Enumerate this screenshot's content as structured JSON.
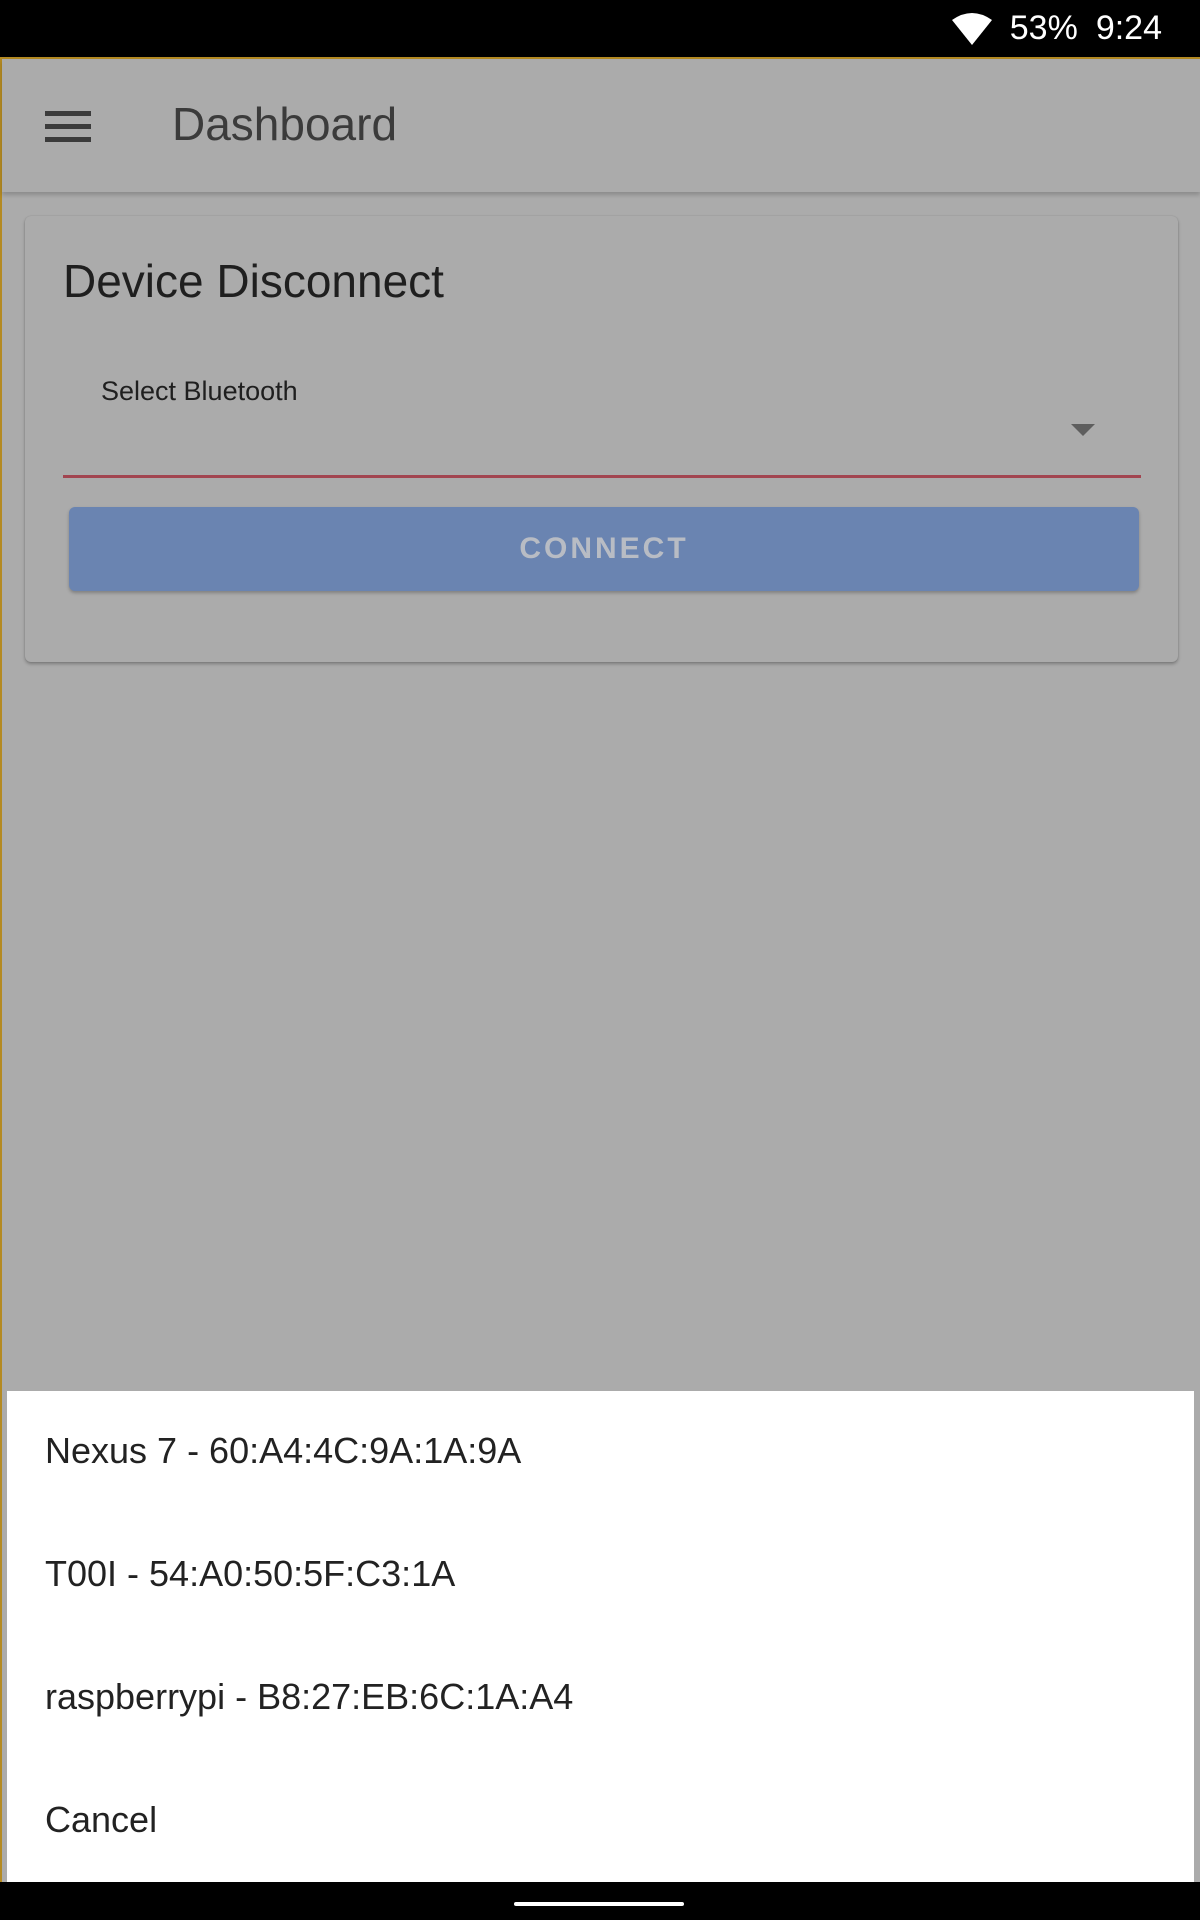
{
  "status_bar": {
    "battery": "53%",
    "time": "9:24",
    "icons": [
      "wifi-icon"
    ]
  },
  "toolbar": {
    "menu_icon": "menu-icon",
    "title": "Dashboard"
  },
  "card": {
    "title": "Device Disconnect",
    "select": {
      "label": "Select Bluetooth",
      "value": "",
      "arrow_icon": "dropdown-arrow-icon"
    },
    "connect_label": "CONNECT"
  },
  "sheet": {
    "items": [
      {
        "label": "Nexus 7 - 60:A4:4C:9A:1A:9A"
      },
      {
        "label": "T00I - 54:A0:50:5F:C3:1A"
      },
      {
        "label": "raspberrypi - B8:27:EB:6C:1A:A4"
      },
      {
        "label": "Cancel"
      }
    ]
  },
  "colors": {
    "scrim_background": "#ababab",
    "connect_button": "#6a84b1",
    "underline_accent": "#a24550",
    "sheet_background": "#ffffff"
  }
}
